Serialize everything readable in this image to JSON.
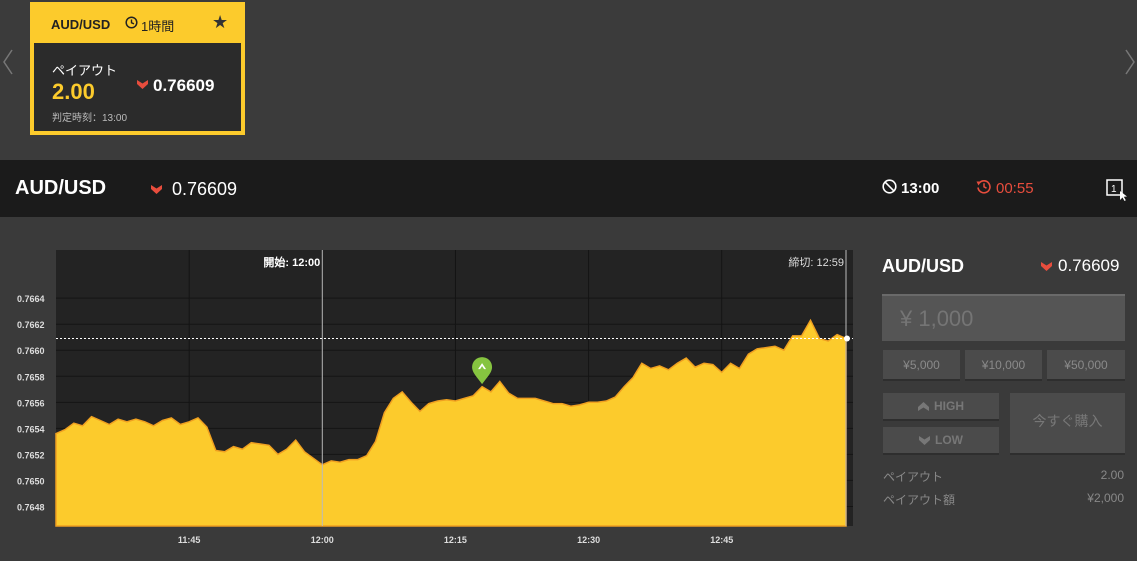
{
  "carousel": {
    "prev_icon": "chevron-left-icon",
    "next_icon": "chevron-right-icon",
    "card": {
      "pair": "AUD/USD",
      "period": "1時間",
      "payout_label": "ペイアウト",
      "payout": "2.00",
      "price": "0.76609",
      "expiry_label": "判定時刻：13:00",
      "accent": "#fccb2c"
    }
  },
  "asset_bar": {
    "name": "AUD/USD",
    "price": "0.76609",
    "expiry_time": "13:00",
    "remaining": "00:55",
    "down_color": "#e84d3d"
  },
  "chart": {
    "start_label": "開始: 12:00",
    "end_label": "締切: 12:59",
    "y_ticks": [
      "0.7664",
      "0.7662",
      "0.7660",
      "0.7658",
      "0.7656",
      "0.7654",
      "0.7652",
      "0.7650",
      "0.7648"
    ],
    "x_ticks": [
      "11:45",
      "12:00",
      "12:15",
      "12:30",
      "12:45"
    ]
  },
  "chart_data": {
    "type": "area",
    "ylim": [
      0.76465,
      0.76677
    ],
    "xlim_minutes": [
      0,
      89
    ],
    "x_tick_minutes": [
      15,
      30,
      45,
      60,
      75
    ],
    "start_minute": 30,
    "end_minute": 89,
    "current_level": 0.76609,
    "entry_marker": {
      "minute": 48,
      "value": 0.76574
    },
    "series": [
      {
        "color": "#fccb2c",
        "points": [
          [
            0,
            0.76536
          ],
          [
            1,
            0.76539
          ],
          [
            2,
            0.76544
          ],
          [
            3,
            0.76542
          ],
          [
            4,
            0.76549
          ],
          [
            5,
            0.76546
          ],
          [
            6,
            0.76543
          ],
          [
            7,
            0.76547
          ],
          [
            8,
            0.76545
          ],
          [
            9,
            0.76547
          ],
          [
            10,
            0.76545
          ],
          [
            11,
            0.76542
          ],
          [
            12,
            0.76546
          ],
          [
            13,
            0.76548
          ],
          [
            14,
            0.76543
          ],
          [
            15,
            0.76545
          ],
          [
            16,
            0.76548
          ],
          [
            17,
            0.76541
          ],
          [
            18,
            0.76523
          ],
          [
            19,
            0.76522
          ],
          [
            20,
            0.76526
          ],
          [
            21,
            0.76524
          ],
          [
            22,
            0.76529
          ],
          [
            23,
            0.76528
          ],
          [
            24,
            0.76527
          ],
          [
            25,
            0.7652
          ],
          [
            26,
            0.76524
          ],
          [
            27,
            0.76531
          ],
          [
            28,
            0.76522
          ],
          [
            29,
            0.76517
          ],
          [
            30,
            0.76512
          ],
          [
            31,
            0.76515
          ],
          [
            32,
            0.76514
          ],
          [
            33,
            0.76516
          ],
          [
            34,
            0.76516
          ],
          [
            35,
            0.76519
          ],
          [
            36,
            0.7653
          ],
          [
            37,
            0.76552
          ],
          [
            38,
            0.76563
          ],
          [
            39,
            0.76568
          ],
          [
            40,
            0.7656
          ],
          [
            41,
            0.76553
          ],
          [
            42,
            0.76559
          ],
          [
            43,
            0.76561
          ],
          [
            44,
            0.76562
          ],
          [
            45,
            0.76561
          ],
          [
            46,
            0.76563
          ],
          [
            47,
            0.76565
          ],
          [
            48,
            0.76572
          ],
          [
            49,
            0.76568
          ],
          [
            50,
            0.76576
          ],
          [
            51,
            0.76567
          ],
          [
            52,
            0.76563
          ],
          [
            53,
            0.76563
          ],
          [
            54,
            0.76563
          ],
          [
            55,
            0.76561
          ],
          [
            56,
            0.76559
          ],
          [
            57,
            0.76559
          ],
          [
            58,
            0.76557
          ],
          [
            59,
            0.76558
          ],
          [
            60,
            0.7656
          ],
          [
            61,
            0.7656
          ],
          [
            62,
            0.76561
          ],
          [
            63,
            0.76564
          ],
          [
            64,
            0.76572
          ],
          [
            65,
            0.76579
          ],
          [
            66,
            0.7659
          ],
          [
            67,
            0.76586
          ],
          [
            68,
            0.76588
          ],
          [
            69,
            0.76585
          ],
          [
            70,
            0.7659
          ],
          [
            71,
            0.76594
          ],
          [
            72,
            0.76587
          ],
          [
            73,
            0.7659
          ],
          [
            74,
            0.76589
          ],
          [
            75,
            0.76583
          ],
          [
            76,
            0.7659
          ],
          [
            77,
            0.76586
          ],
          [
            78,
            0.76597
          ],
          [
            79,
            0.76601
          ],
          [
            80,
            0.76602
          ],
          [
            81,
            0.76603
          ],
          [
            82,
            0.766
          ],
          [
            83,
            0.76611
          ],
          [
            84,
            0.76611
          ],
          [
            85,
            0.76623
          ],
          [
            86,
            0.76609
          ],
          [
            87,
            0.76607
          ],
          [
            88,
            0.76612
          ],
          [
            89,
            0.76609
          ]
        ]
      }
    ]
  },
  "panel": {
    "asset": "AUD/USD",
    "price": "0.76609",
    "amount_placeholder": "¥ 1,000",
    "presets": [
      "¥5,000",
      "¥10,000",
      "¥50,000"
    ],
    "high_label": "HIGH",
    "low_label": "LOW",
    "buy_label": "今すぐ購入",
    "payout_label": "ペイアウト",
    "payout_value": "2.00",
    "payout_amount_label": "ペイアウト額",
    "payout_amount_value": "¥2,000"
  }
}
